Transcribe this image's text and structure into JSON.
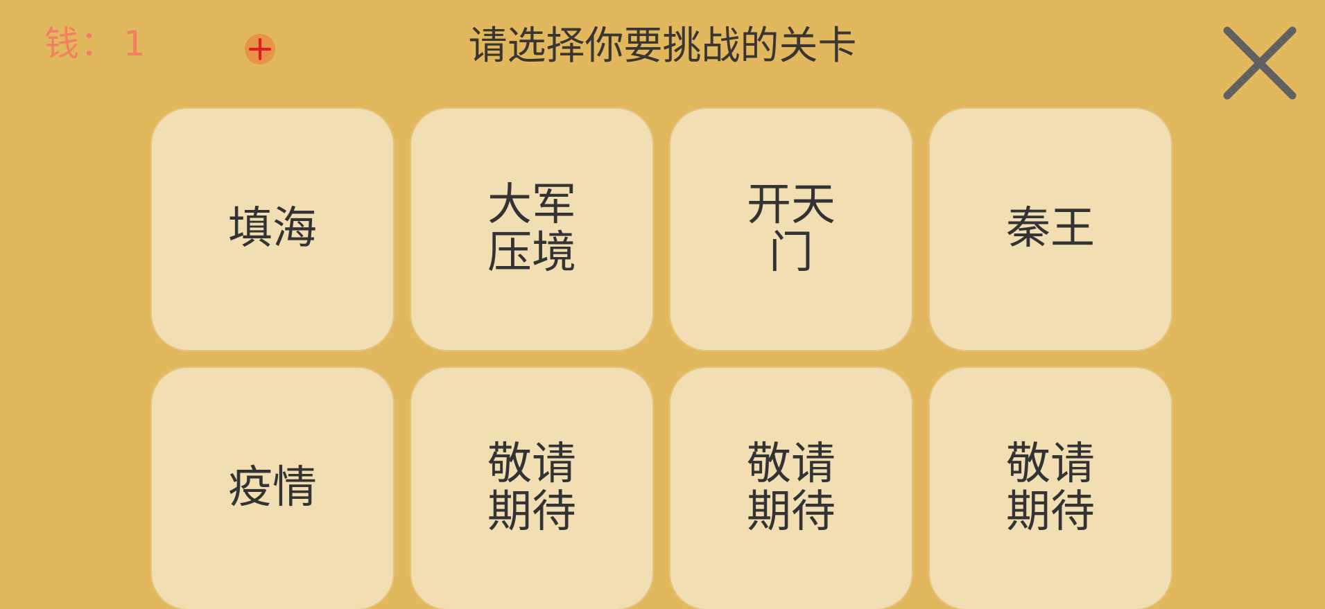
{
  "header": {
    "money_label": "钱：",
    "money_value": "1",
    "title": "请选择你要挑战的关卡"
  },
  "icons": {
    "add": "plus-icon",
    "close": "close-icon"
  },
  "colors": {
    "background": "#e2b85e",
    "tile": "#f1deb3",
    "money_text": "#f08060",
    "add_button_fill": "#e8934a",
    "add_button_plus": "#e8191a",
    "close_icon": "#606060"
  },
  "levels": [
    {
      "label": "填海"
    },
    {
      "label": "大军压境"
    },
    {
      "label": "开天门"
    },
    {
      "label": "秦王"
    },
    {
      "label": "疫情"
    },
    {
      "label": "敬请期待"
    },
    {
      "label": "敬请期待"
    },
    {
      "label": "敬请期待"
    }
  ]
}
